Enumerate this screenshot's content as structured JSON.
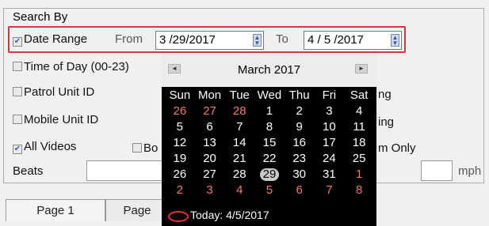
{
  "group_title": "Search By",
  "date_range": {
    "label": "Date Range",
    "checked": true,
    "from_label": "From",
    "from_value": "3 /29/2017",
    "to_label": "To",
    "to_value": "4 / 5 /2017"
  },
  "time_of_day": {
    "label": "Time of Day (00-23)",
    "checked": false
  },
  "patrol_unit": {
    "label": "Patrol Unit ID",
    "checked": false
  },
  "mobile_unit": {
    "label": "Mobile Unit ID",
    "checked": false
  },
  "all_videos": {
    "label": "All Videos",
    "checked": true
  },
  "second_checkbox_label": "Bo",
  "beats_label": "Beats",
  "speed_unit": "mph",
  "partial_texts": {
    "row_patrol": "ng",
    "row_mobile": "ing",
    "row_videos": "m Only"
  },
  "tabs": [
    {
      "label": "Page 1"
    },
    {
      "label": "Page"
    }
  ],
  "calendar": {
    "month_title": "March 2017",
    "weekdays": [
      "Sun",
      "Mon",
      "Tue",
      "Wed",
      "Thu",
      "Fri",
      "Sat"
    ],
    "weeks": [
      [
        {
          "d": "26",
          "out": true
        },
        {
          "d": "27",
          "out": true
        },
        {
          "d": "28",
          "out": true
        },
        {
          "d": "1"
        },
        {
          "d": "2"
        },
        {
          "d": "3"
        },
        {
          "d": "4"
        }
      ],
      [
        {
          "d": "5"
        },
        {
          "d": "6"
        },
        {
          "d": "7"
        },
        {
          "d": "8"
        },
        {
          "d": "9"
        },
        {
          "d": "10"
        },
        {
          "d": "11"
        }
      ],
      [
        {
          "d": "12"
        },
        {
          "d": "13"
        },
        {
          "d": "14"
        },
        {
          "d": "15"
        },
        {
          "d": "16"
        },
        {
          "d": "17"
        },
        {
          "d": "18"
        }
      ],
      [
        {
          "d": "19"
        },
        {
          "d": "20"
        },
        {
          "d": "21"
        },
        {
          "d": "22"
        },
        {
          "d": "23"
        },
        {
          "d": "24"
        },
        {
          "d": "25"
        }
      ],
      [
        {
          "d": "26"
        },
        {
          "d": "27"
        },
        {
          "d": "28"
        },
        {
          "d": "29",
          "selected": true
        },
        {
          "d": "30"
        },
        {
          "d": "31"
        },
        {
          "d": "1",
          "out": true
        }
      ],
      [
        {
          "d": "2",
          "out": true
        },
        {
          "d": "3",
          "out": true
        },
        {
          "d": "4",
          "out": true
        },
        {
          "d": "5",
          "out": true
        },
        {
          "d": "6",
          "out": true
        },
        {
          "d": "7",
          "out": true
        },
        {
          "d": "8",
          "out": true
        }
      ]
    ],
    "today_text": "Today: 4/5/2017",
    "prev_icon": "left-arrow",
    "next_icon": "right-arrow"
  },
  "colors": {
    "highlight": "#d9353d",
    "calendar_bg": "#000000",
    "out_of_month": "#f07a7a"
  }
}
